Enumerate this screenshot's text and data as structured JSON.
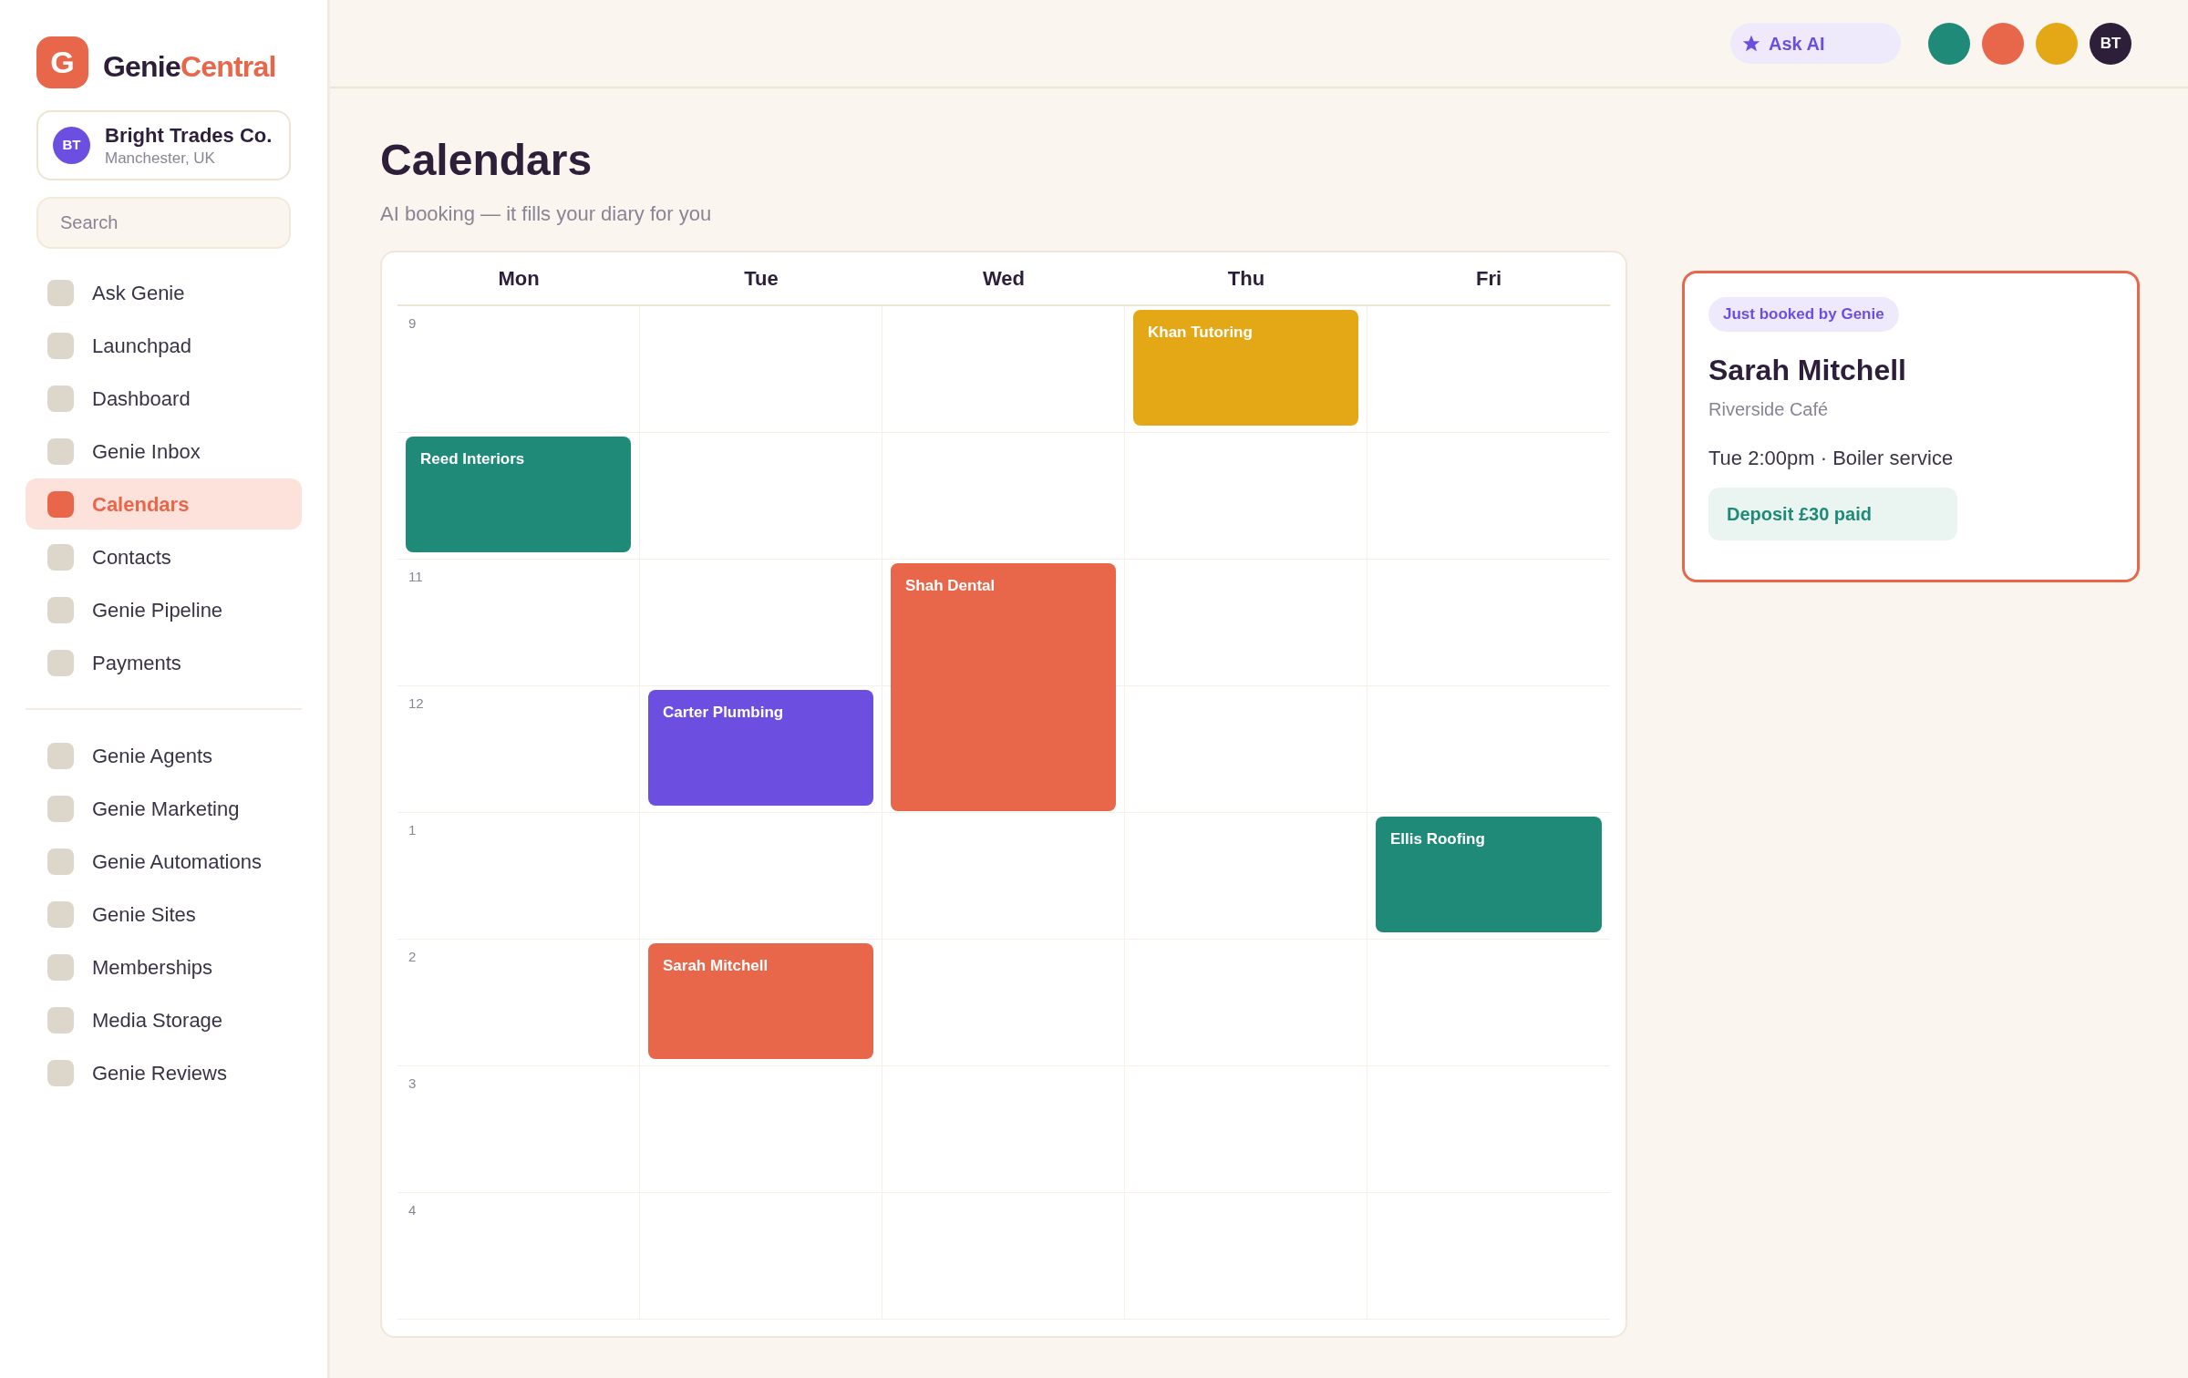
{
  "brand": {
    "logo_letter": "G",
    "name_dark": "Genie",
    "name_accent": "Central"
  },
  "org": {
    "initials": "BT",
    "name": "Bright Trades Co.",
    "location": "Manchester, UK"
  },
  "search": {
    "placeholder": "Search"
  },
  "nav_groups": [
    [
      {
        "label": "Ask Genie",
        "selected": false
      },
      {
        "label": "Launchpad",
        "selected": false
      },
      {
        "label": "Dashboard",
        "selected": false
      },
      {
        "label": "Genie Inbox",
        "selected": false
      },
      {
        "label": "Calendars",
        "selected": true
      },
      {
        "label": "Contacts",
        "selected": false
      },
      {
        "label": "Genie Pipeline",
        "selected": false
      },
      {
        "label": "Payments",
        "selected": false
      }
    ],
    [
      {
        "label": "Genie Agents",
        "selected": false
      },
      {
        "label": "Genie Marketing",
        "selected": false
      },
      {
        "label": "Genie Automations",
        "selected": false
      },
      {
        "label": "Genie Sites",
        "selected": false
      },
      {
        "label": "Memberships",
        "selected": false
      },
      {
        "label": "Media Storage",
        "selected": false
      },
      {
        "label": "Genie Reviews",
        "selected": false
      }
    ]
  ],
  "topbar": {
    "ask_ai": "Ask AI",
    "avatars": [
      {
        "color": "#1f8a78"
      },
      {
        "color": "#e8664a"
      },
      {
        "color": "#e4a817"
      },
      {
        "color": "#2d1f3a",
        "initials": "BT"
      }
    ]
  },
  "page": {
    "title": "Calendars",
    "subtitle": "AI booking — it fills your diary for you"
  },
  "calendar": {
    "days": [
      "Mon",
      "Tue",
      "Wed",
      "Thu",
      "Fri"
    ],
    "rows": [
      {
        "label": "9",
        "cells": [
          null,
          null,
          null,
          {
            "title": "Khan Tutoring",
            "color": "#e4a817",
            "kind": "one-hour"
          },
          null
        ]
      },
      {
        "cells": [
          {
            "title": "Reed Interiors",
            "color": "#1f8a78",
            "kind": "one-hour"
          },
          null,
          null,
          null,
          null
        ]
      },
      {
        "label": "11",
        "cells": [
          null,
          null,
          {
            "title": "Shah Dental",
            "color": "#e8664a",
            "kind": "two-hour"
          },
          null,
          null
        ]
      },
      {
        "label": "12",
        "cells": [
          null,
          {
            "title": "Carter Plumbing",
            "color": "#6c4fe0",
            "kind": "one-hour"
          },
          null,
          null,
          null
        ]
      },
      {
        "label": "1",
        "cells": [
          null,
          null,
          null,
          null,
          {
            "title": "Ellis Roofing",
            "color": "#1f8a78",
            "kind": "one-hour"
          }
        ]
      },
      {
        "label": "2",
        "cells": [
          null,
          {
            "title": "Sarah Mitchell",
            "color": "#e8664a",
            "kind": "one-hour"
          },
          null,
          null,
          null
        ]
      },
      {
        "label": "3",
        "cells": [
          null,
          null,
          null,
          null,
          null
        ]
      },
      {
        "label": "4",
        "cells": [
          null,
          null,
          null,
          null,
          null
        ]
      }
    ]
  },
  "booking": {
    "badge": "Just booked by Genie",
    "name": "Sarah Mitchell",
    "place": "Riverside Café",
    "when": "Tue 2:00pm · Boiler service",
    "deposit": "Deposit £30 paid"
  }
}
